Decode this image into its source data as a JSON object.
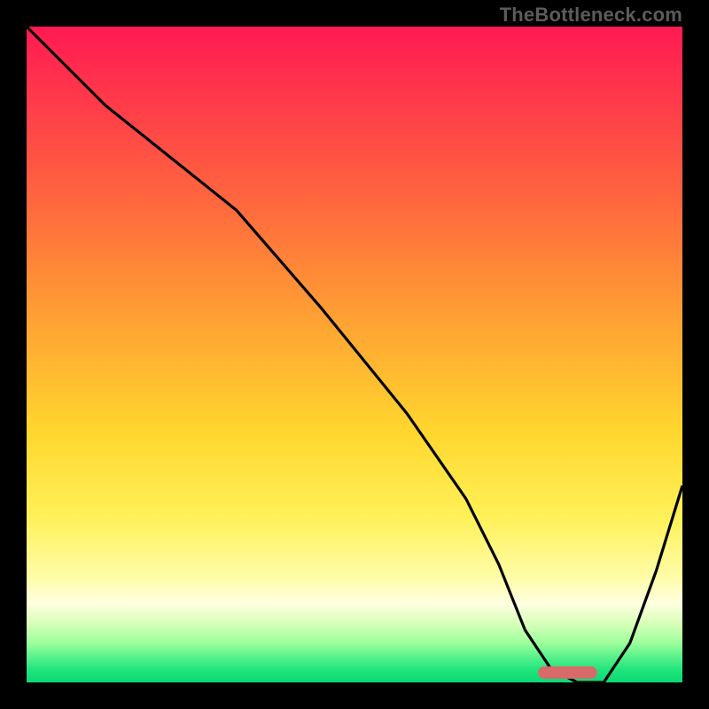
{
  "watermark": "TheBottleneck.com",
  "colors": {
    "frame": "#000000",
    "watermark": "#5c5c5c",
    "curve": "#000000",
    "marker": "#d86a6a",
    "gradient_stops": [
      "#ff1a52",
      "#ff3c4a",
      "#ff6b3d",
      "#ffa233",
      "#ffd72e",
      "#fff15a",
      "#fffca8",
      "#ffffe0",
      "#d8ffb8",
      "#9cff9c",
      "#5cf28c",
      "#22e57d",
      "#0cd873"
    ]
  },
  "chart_data": {
    "type": "line",
    "title": "",
    "xlabel": "",
    "ylabel": "",
    "x_range": [
      0,
      100
    ],
    "y_range": [
      0,
      100
    ],
    "series": [
      {
        "name": "bottleneck-curve",
        "x": [
          0,
          5,
          12,
          22,
          32,
          45,
          58,
          67,
          72,
          76,
          80,
          84,
          88,
          92,
          96,
          100
        ],
        "y": [
          100,
          95,
          88,
          80,
          72,
          57,
          41,
          28,
          18,
          8,
          2,
          0,
          0,
          6,
          17,
          30
        ]
      }
    ],
    "annotations": [
      {
        "name": "optimal-marker",
        "shape": "capsule",
        "x_start": 78,
        "x_end": 87,
        "y": 1.5,
        "color": "#d86a6a"
      }
    ],
    "ylim": [
      0,
      100
    ],
    "xlim": [
      0,
      100
    ]
  }
}
